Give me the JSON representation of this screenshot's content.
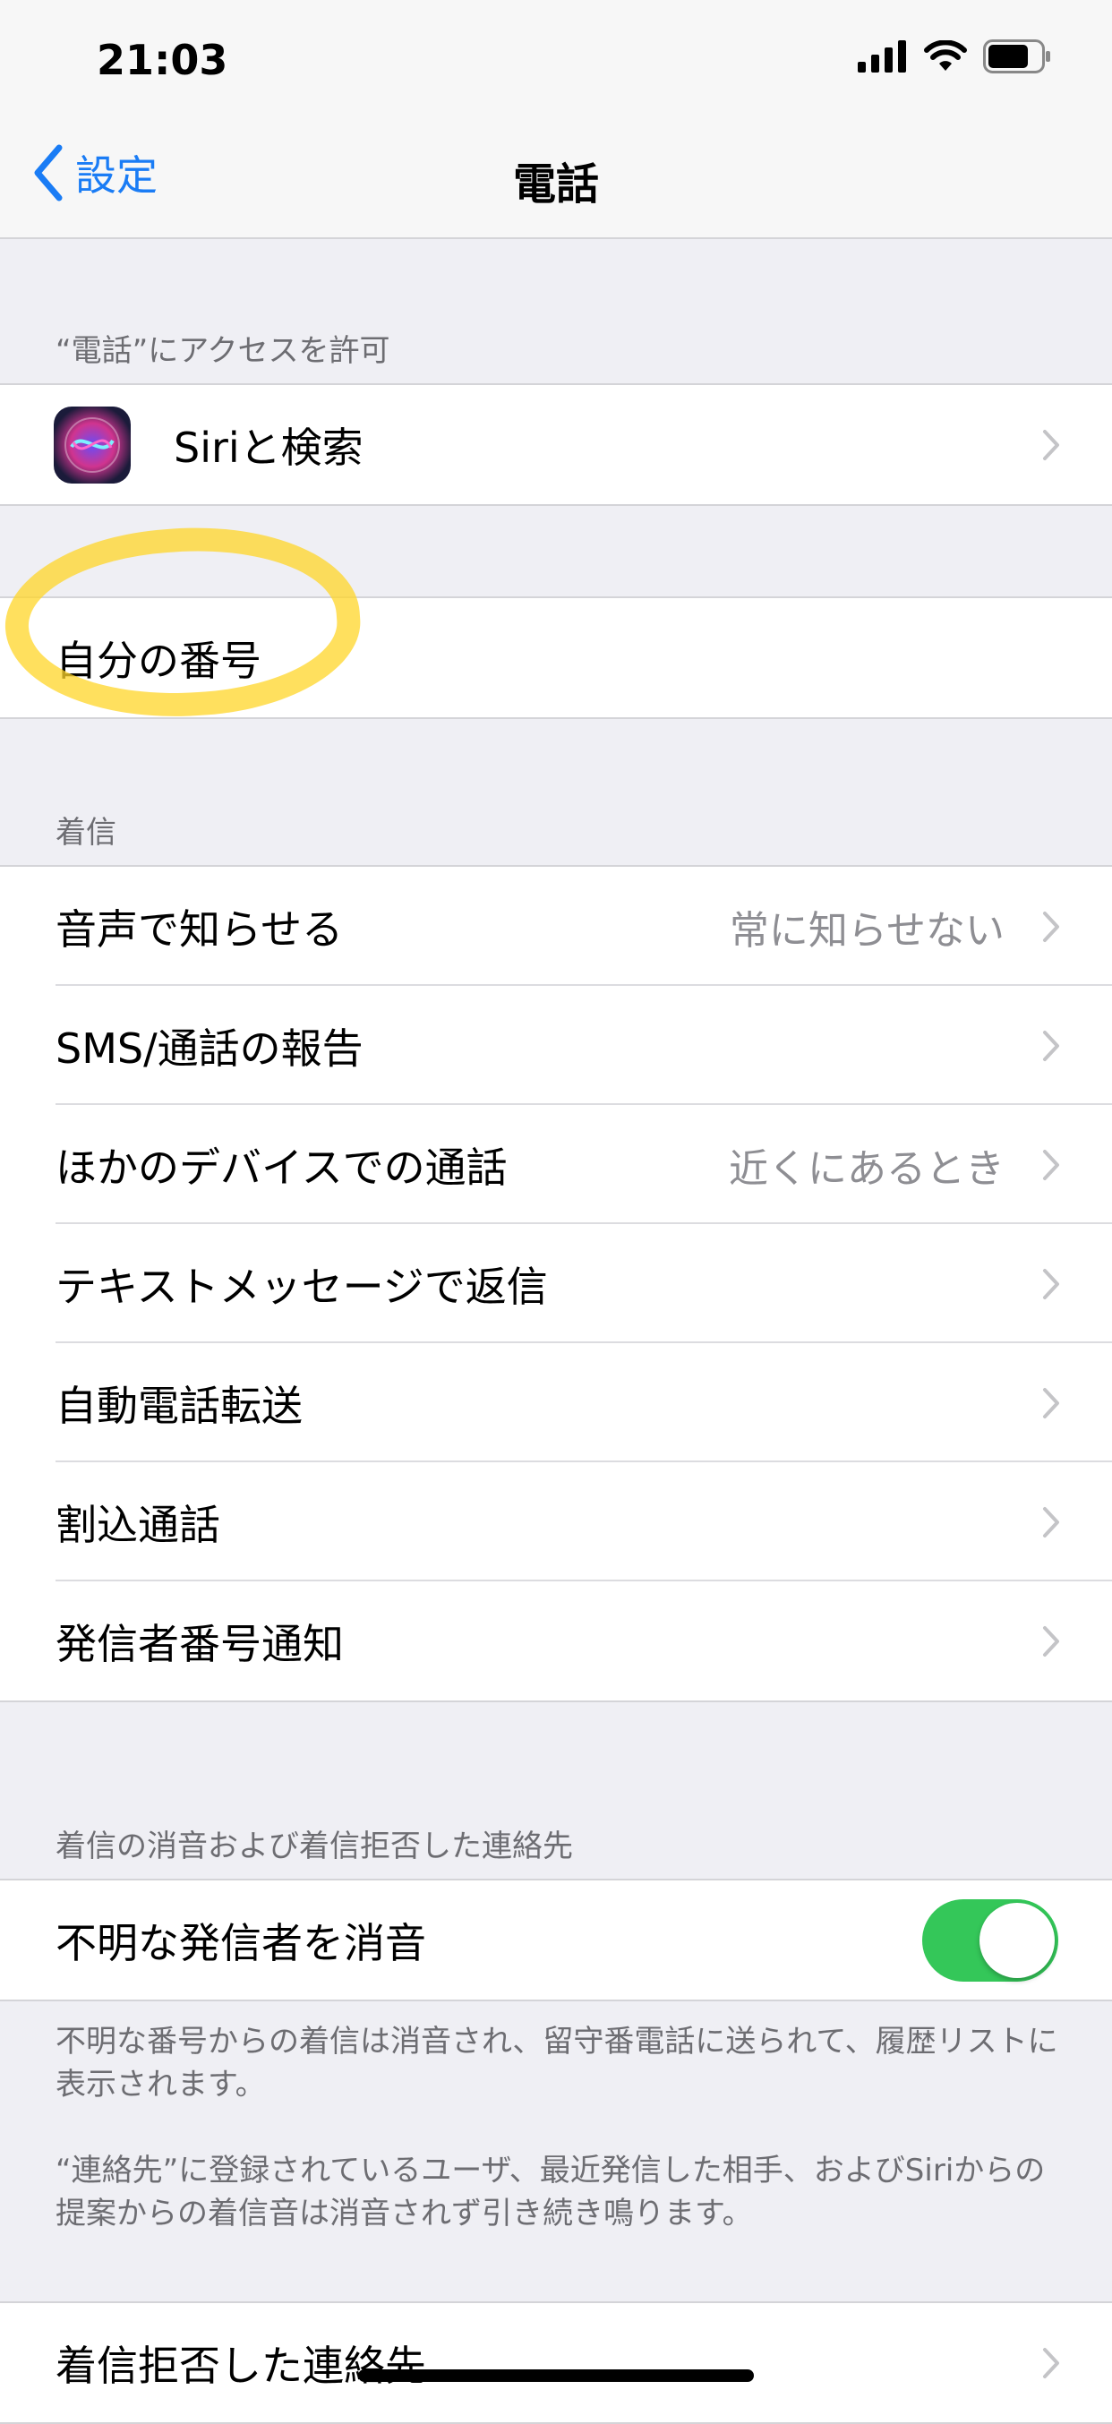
{
  "status_bar": {
    "time": "21:03"
  },
  "nav": {
    "back_label": "設定",
    "title": "電話"
  },
  "sections": {
    "access_header": "“電話”にアクセスを許可",
    "siri_search": "Siriと検索",
    "my_number": "自分の番号",
    "incoming_header": "着信",
    "announce_calls": {
      "label": "音声で知らせる",
      "value": "常に知らせない"
    },
    "sms_call_reporting": "SMS/通話の報告",
    "calls_other_devices": {
      "label": "ほかのデバイスでの通話",
      "value": "近くにあるとき"
    },
    "respond_with_text": "テキストメッセージで返信",
    "call_forwarding": "自動電話転送",
    "call_waiting": "割込通話",
    "show_caller_id": "発信者番号通知",
    "silence_header": "着信の消音および着信拒否した連絡先",
    "silence_unknown": {
      "label": "不明な発信者を消音",
      "enabled": true
    },
    "footnote_1": "不明な番号からの着信は消音され、留守番電話に送られて、履歴リストに表示されます。",
    "footnote_2": "“連絡先”に登録されているユーザ、最近発信した相手、およびSiriからの提案からの着信音は消音されず引き続き鳴ります。",
    "blocked_contacts": "着信拒否した連絡先"
  },
  "colors": {
    "accent": "#1a7cf5",
    "toggle_on": "#34c759",
    "highlight": "#ffd628"
  }
}
